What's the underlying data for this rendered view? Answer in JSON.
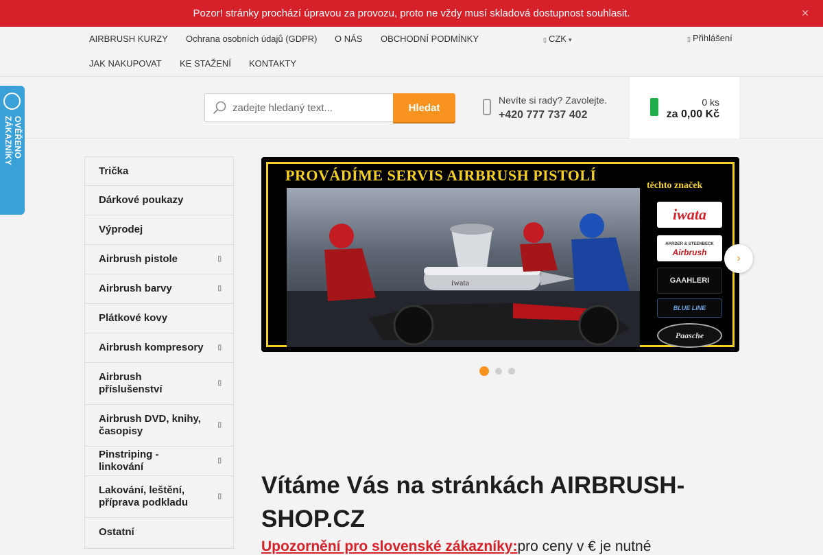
{
  "notice": {
    "text": "Pozor! stránky prochází úpravou za provozu, proto ne vždy musí skladová dostupnost souhlasit.",
    "close_glyph": "✕"
  },
  "nav": {
    "items": [
      "AIRBRUSH KURZY",
      "Ochrana osobních údajů (GDPR)",
      "O NÁS",
      "OBCHODNÍ PODMÍNKY",
      "JAK NAKUPOVAT",
      "KE STAŽENÍ",
      "KONTAKTY"
    ],
    "currency": "CZK",
    "login": "Přihlášení"
  },
  "search": {
    "placeholder": "zadejte hledaný text...",
    "button": "Hledat"
  },
  "help": {
    "text": "Nevíte si rady? Zavolejte.",
    "phone": "+420 777 737 402"
  },
  "cart": {
    "count": "0 ks",
    "total": "za 0,00 Kč"
  },
  "verified_badge": {
    "text": "OVĚŘENO ZÁKAZNÍKY"
  },
  "sidebar": {
    "categories": [
      {
        "label": "Trička",
        "has_sub": false
      },
      {
        "label": "Dárkové poukazy",
        "has_sub": false
      },
      {
        "label": "Výprodej",
        "has_sub": false
      },
      {
        "label": "Airbrush pistole",
        "has_sub": true
      },
      {
        "label": "Airbrush barvy",
        "has_sub": true
      },
      {
        "label": "Plátkové kovy",
        "has_sub": false
      },
      {
        "label": "Airbrush kompresory",
        "has_sub": true
      },
      {
        "label": "Airbrush příslušenství",
        "has_sub": true
      },
      {
        "label": "Airbrush DVD, knihy, časopisy",
        "has_sub": true
      },
      {
        "label": "Pinstriping - linkování",
        "has_sub": true
      },
      {
        "label": "Lakování, leštění, příprava podkladu",
        "has_sub": true
      },
      {
        "label": "Ostatní",
        "has_sub": false
      }
    ]
  },
  "banner": {
    "headline": "PROVÁDÍME SERVIS AIRBRUSH PISTOLÍ",
    "brand_title": "těchto značek",
    "brands": [
      "iwata",
      "Airbrush",
      "GAAHLERI",
      "BLUE LINE",
      "Paasche"
    ],
    "harder_small": "HARDER & STEENBECK",
    "gun_label": "iwata",
    "slide_count": 3,
    "active_slide": 1
  },
  "main": {
    "welcome": "Vítáme Vás na stránkách AIRBRUSH-SHOP.CZ",
    "warning_link": "Upozornění pro slovenské zákazníky:",
    "warning_rest": "pro ceny v € je nutné"
  },
  "colors": {
    "notice_bg": "#d6202a",
    "accent": "#f7931e",
    "cart_icon": "#1fae4b",
    "badge": "#39a0d8"
  }
}
